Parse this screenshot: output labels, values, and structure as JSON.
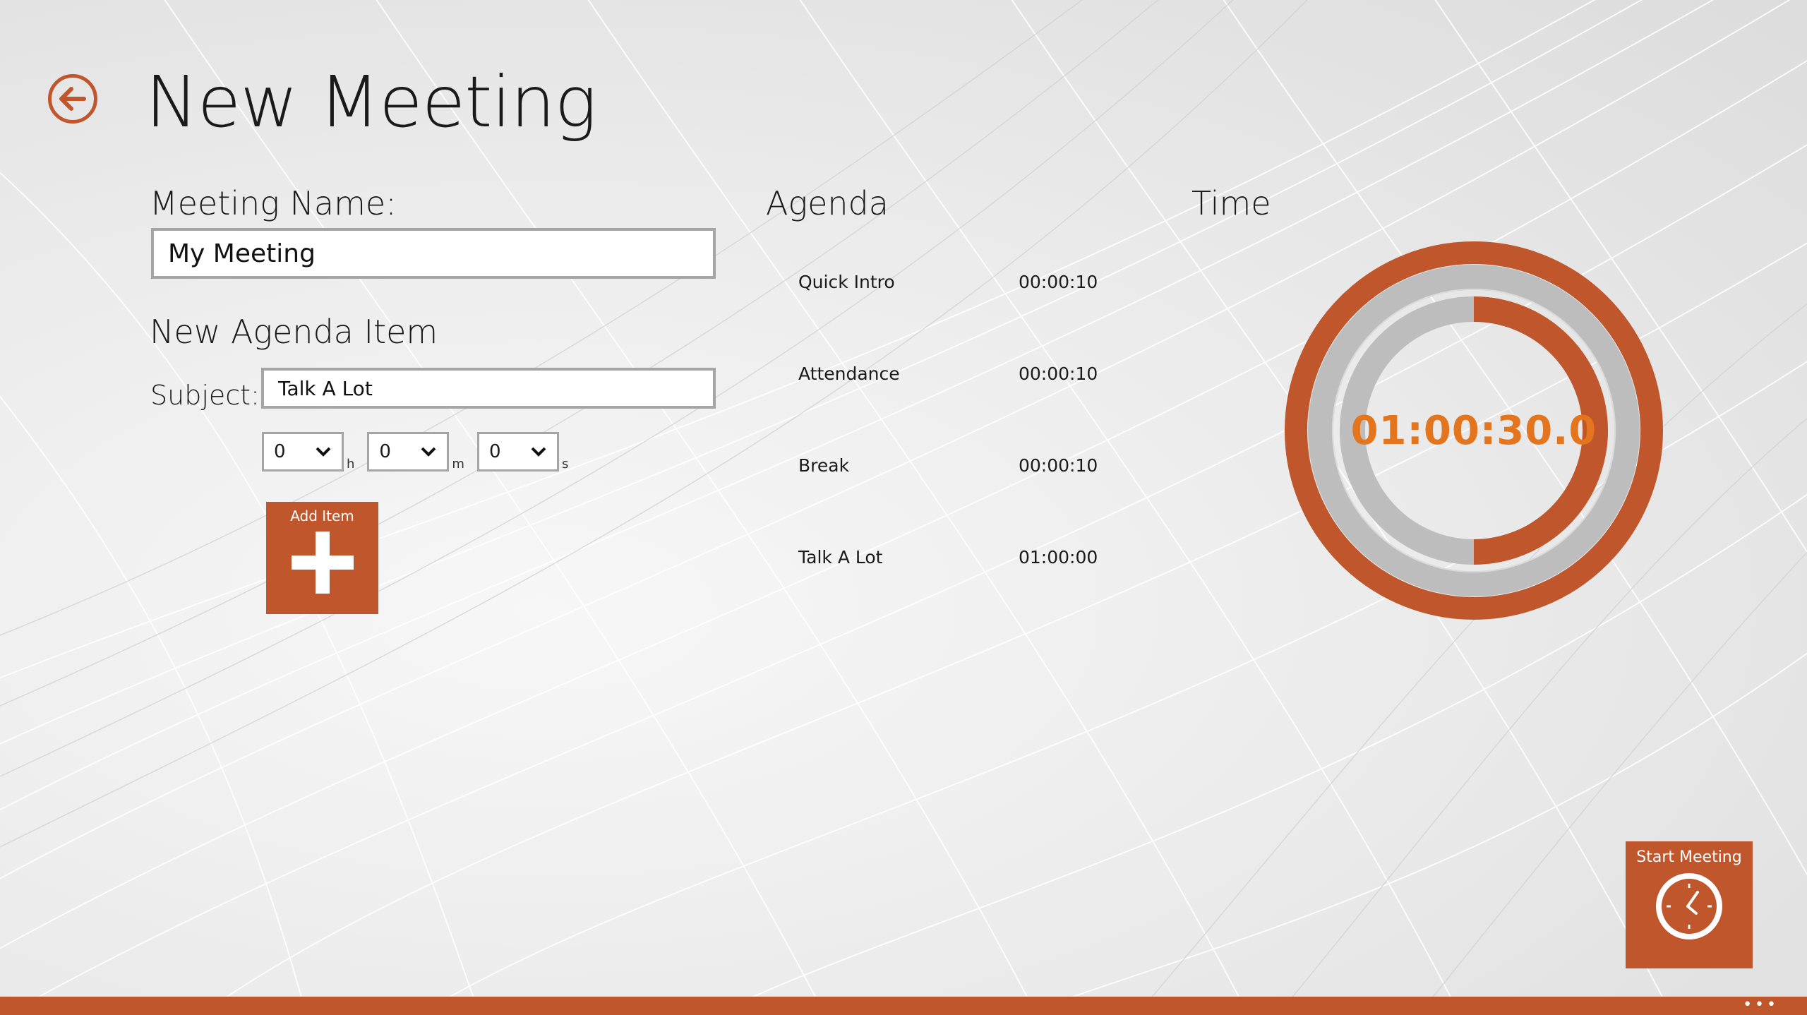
{
  "page": {
    "title": "New Meeting"
  },
  "form": {
    "meeting_name_label": "Meeting Name:",
    "meeting_name_value": "My Meeting",
    "new_item_label": "New Agenda Item",
    "subject_label": "Subject:",
    "subject_value": "Talk A Lot",
    "duration": {
      "hours": {
        "value": "0",
        "unit": "h"
      },
      "minutes": {
        "value": "0",
        "unit": "m"
      },
      "seconds": {
        "value": "0",
        "unit": "s"
      }
    },
    "add_item_label": "Add Item"
  },
  "agenda": {
    "heading": "Agenda",
    "items": [
      {
        "subject": "Quick Intro",
        "time": "00:00:10"
      },
      {
        "subject": "Attendance",
        "time": "00:00:10"
      },
      {
        "subject": "Break",
        "time": "00:00:10"
      },
      {
        "subject": "Talk A Lot",
        "time": "01:00:00"
      }
    ]
  },
  "time": {
    "heading": "Time",
    "total": "01:00:30.0",
    "progress_fraction": 0.5
  },
  "actions": {
    "start_meeting_label": "Start Meeting",
    "more_label": "•••"
  },
  "colors": {
    "accent": "#c0562b",
    "timer_text": "#e2751e",
    "ring_grey": "#bdbdbd"
  },
  "icons": {
    "back": "back-arrow-icon",
    "add": "plus-icon",
    "start": "clock-icon",
    "dropdown": "chevron-down-icon"
  }
}
